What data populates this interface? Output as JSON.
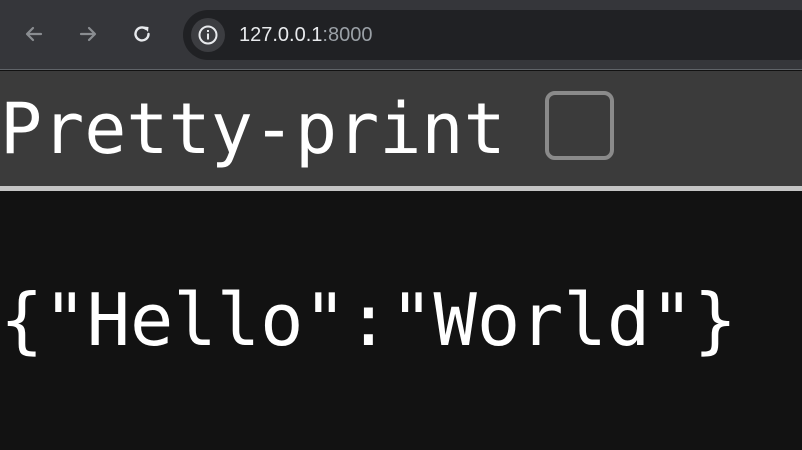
{
  "browser": {
    "url_host": "127.0.0.1",
    "url_port": ":8000",
    "icons": {
      "back": "arrow-left-icon",
      "forward": "arrow-right-icon",
      "reload": "reload-icon",
      "site_info": "info-icon"
    }
  },
  "controls": {
    "pretty_print_label": "Pretty-print",
    "pretty_print_checked": false
  },
  "content": {
    "json_text": "{\"Hello\":\"World\"}"
  },
  "colors": {
    "toolbar_bg": "#35363a",
    "omnibox_bg": "#202124",
    "controls_bg": "#3b3b3b",
    "page_bg": "#121212",
    "text": "#ffffff"
  }
}
